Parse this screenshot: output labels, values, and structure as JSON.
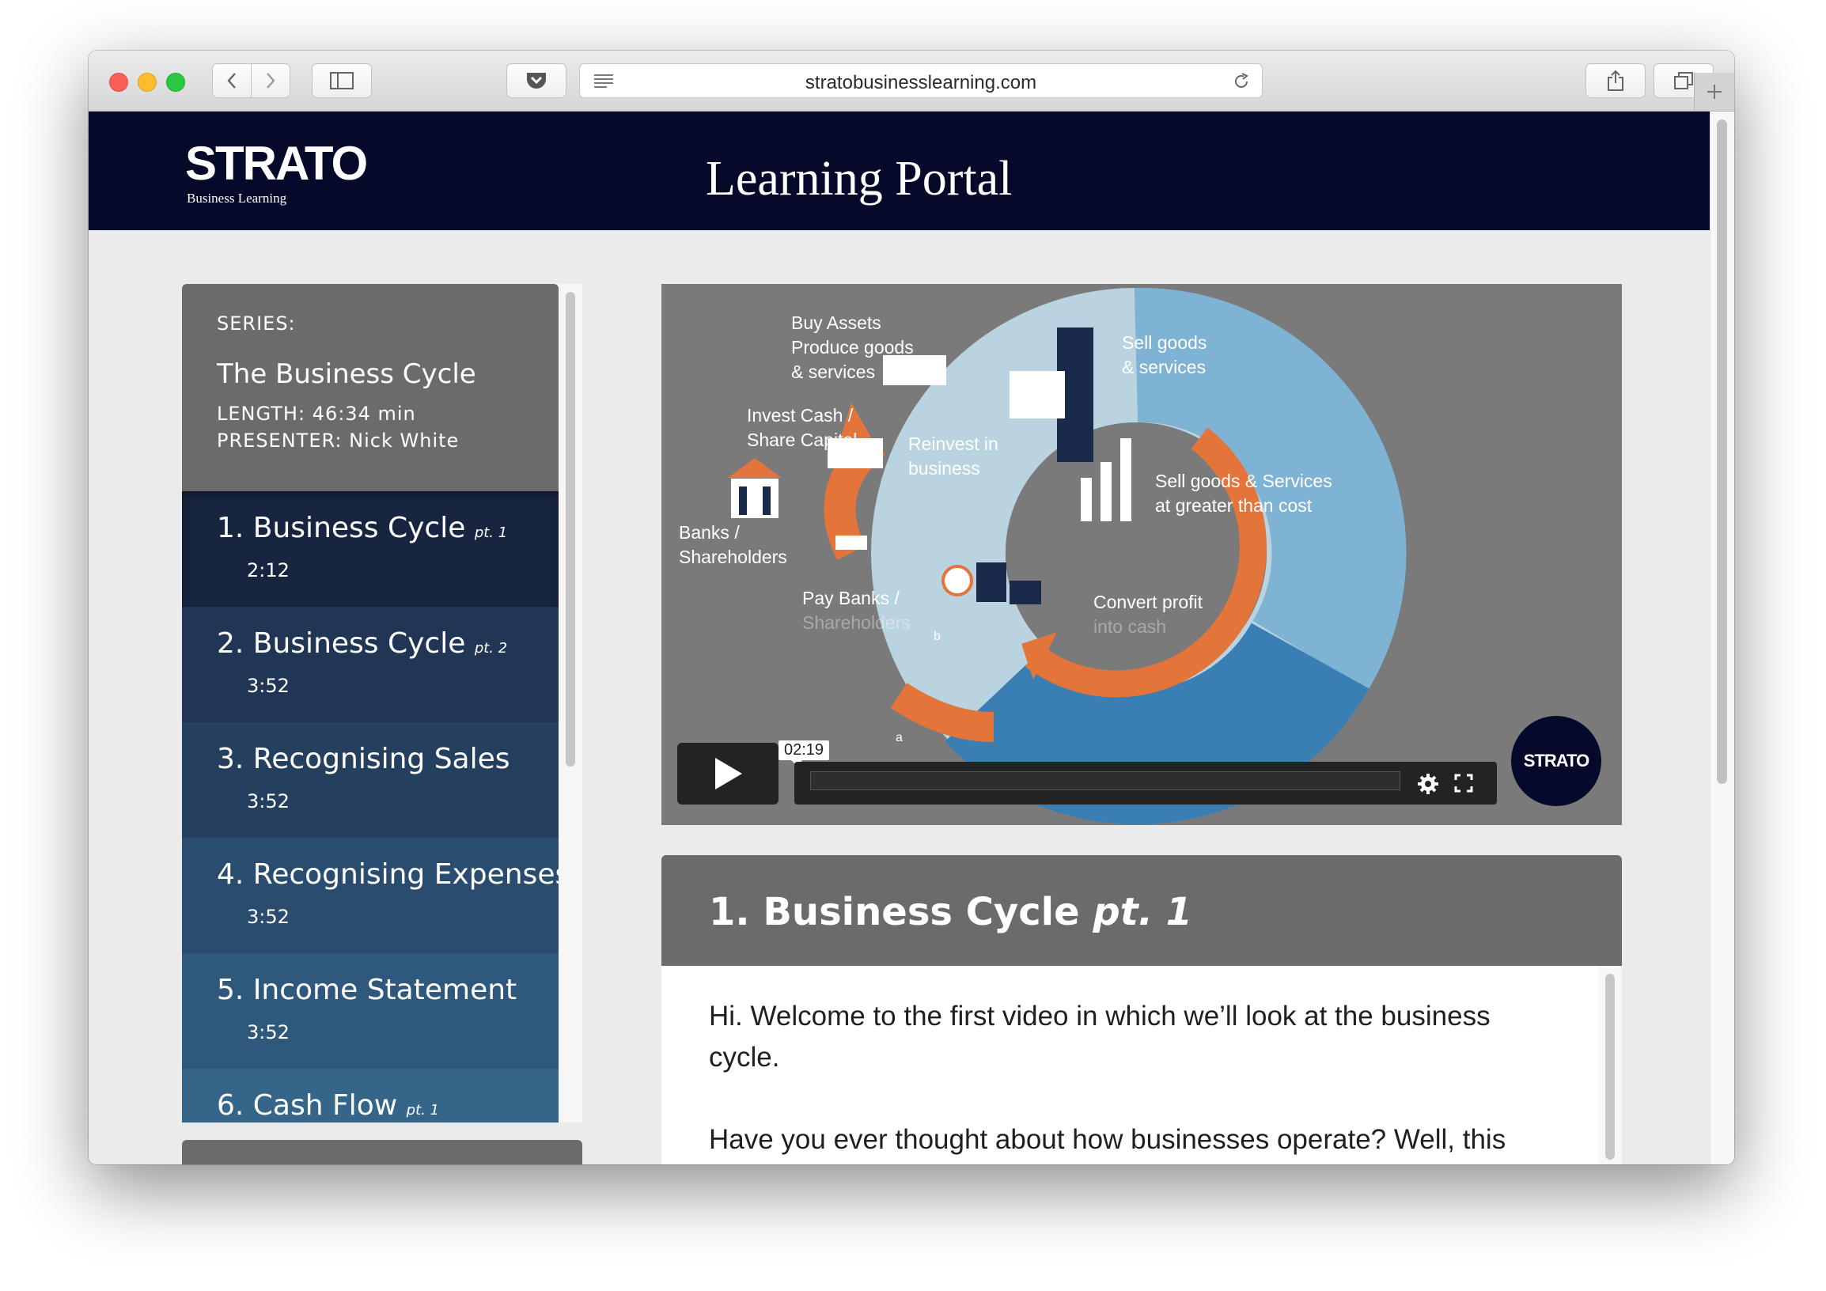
{
  "browser": {
    "url": "stratobusinesslearning.com"
  },
  "site": {
    "logo_text": "STRATO",
    "logo_subtitle": "Business Learning",
    "title": "Learning Portal"
  },
  "series": {
    "label": "SERIES:",
    "title": "The Business Cycle",
    "length_label": "LENGTH:",
    "length_value": "46:34 min",
    "presenter_label": "PRESENTER:",
    "presenter_value": "Nick White"
  },
  "lessons": [
    {
      "title": "1. Business Cycle",
      "suffix": "pt. 1",
      "duration": "2:12",
      "color": "#172540",
      "active": true
    },
    {
      "title": "2. Business Cycle",
      "suffix": "pt. 2",
      "duration": "3:52",
      "color": "#203654"
    },
    {
      "title": "3. Recognising Sales",
      "suffix": "",
      "duration": "3:52",
      "color": "#25405f"
    },
    {
      "title": "4. Recognising Expenses",
      "suffix": "",
      "duration": "3:52",
      "color": "#2a4c6f"
    },
    {
      "title": "5. Income Statement",
      "suffix": "",
      "duration": "3:52",
      "color": "#2f587d"
    },
    {
      "title": "6. Cash Flow",
      "suffix": "pt. 1",
      "duration": "",
      "color": "#356689"
    }
  ],
  "video": {
    "labels": {
      "buy_assets": [
        "Buy Assets",
        "Produce goods",
        "& services"
      ],
      "sell_goods": [
        "Sell goods",
        "& services"
      ],
      "invest_cash": [
        "Invest Cash /",
        "Share Capital"
      ],
      "reinvest": [
        "Reinvest in",
        "business"
      ],
      "sell_greater": [
        "Sell goods & Services",
        "at greater than cost"
      ],
      "banks": [
        "Banks /",
        "Shareholders"
      ],
      "pay_banks": [
        "Pay Banks /",
        "Shareholders"
      ],
      "convert_profit": [
        "Convert profit",
        "into cash"
      ],
      "marker_a": "a",
      "marker_b": "b"
    },
    "current_time": "02:19",
    "badge_text": "STRATO",
    "colors": {
      "orange": "#e3743a",
      "light_blue": "#b9d3e0",
      "mid_blue": "#7fb3d3",
      "dark_blue": "#3a7fb4",
      "navy": "#1a2a4a"
    }
  },
  "current_lesson": {
    "title": "1. Business Cycle",
    "suffix": "pt. 1",
    "paragraphs": [
      "Hi. Welcome to the first video in which we’ll look at the business cycle.",
      "Have you ever thought about how businesses operate? Well, this"
    ]
  }
}
